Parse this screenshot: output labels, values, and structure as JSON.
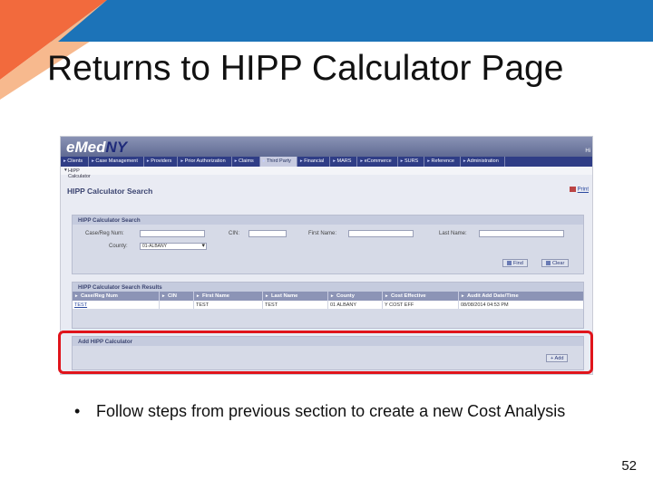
{
  "slide": {
    "title": "Returns to HIPP Calculator Page",
    "bullet": "Follow steps from previous section to create a new Cost Analysis",
    "page_number": "52",
    "colors": {
      "blue_band": "#1c73b8",
      "orange_band": "#f26a3d",
      "highlight": "#e0141b"
    }
  },
  "app": {
    "logo_e": "e",
    "logo_med": "Med",
    "logo_ny": "NY",
    "header_right": "Hi",
    "nav": [
      "Clients",
      "Case Management",
      "Providers",
      "Prior Authorization",
      "Claims",
      "Third Party",
      "Financial",
      "MARS",
      "eCommerce",
      "SURS",
      "Reference",
      "Administration"
    ],
    "breadcrumb": "HIPP Calculator",
    "page_heading": "HIPP Calculator Search",
    "print_label": "Print",
    "search": {
      "header": "HIPP Calculator Search",
      "case_reg_label": "Case/Reg Num:",
      "cin_label": "CIN:",
      "first_name_label": "First Name:",
      "last_name_label": "Last Name:",
      "county_label": "County:",
      "county_value": "01-ALBANY",
      "find_label": "Find",
      "clear_label": "Clear"
    },
    "results": {
      "header": "HIPP Calculator Search Results",
      "columns": [
        "Case/Reg Num",
        "CIN",
        "First Name",
        "Last Name",
        "County",
        "Cost Effective",
        "Audit Add Date/Time"
      ],
      "rows": [
        [
          "TEST",
          "",
          "TEST",
          "TEST",
          "01 ALBANY",
          "Y COST EFF",
          "08/08/2014 04:53 PM"
        ]
      ]
    },
    "add": {
      "header": "Add HIPP Calculator",
      "add_label": "Add"
    }
  }
}
